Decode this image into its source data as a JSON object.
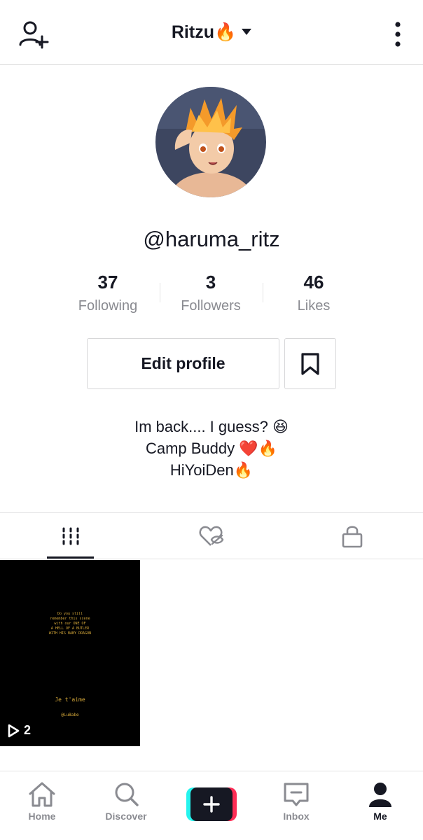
{
  "header": {
    "title": "Ritzu",
    "title_emoji": "🔥",
    "left_icon": "add-user-icon",
    "right_icon": "more-vertical-icon"
  },
  "profile": {
    "username": "@haruma_ritz",
    "stats": [
      {
        "value": "37",
        "label": "Following"
      },
      {
        "value": "3",
        "label": "Followers"
      },
      {
        "value": "46",
        "label": "Likes"
      }
    ],
    "edit_button": "Edit profile",
    "bio": [
      "Im back.... I guess? 😆",
      "Camp Buddy ❤️🔥",
      "HiYoiDen🔥"
    ]
  },
  "tabs": [
    {
      "icon": "grid-icon",
      "active": true
    },
    {
      "icon": "liked-hidden-icon",
      "active": false
    },
    {
      "icon": "lock-icon",
      "active": false
    }
  ],
  "videos": [
    {
      "caption_lines": [
        "Do you still",
        "remember this scene",
        "with our ONE OF",
        "A HELL OF A BUTLER",
        "WITH HIS BABY DRAGON"
      ],
      "caption_bottom": "Je t'aime",
      "caption_tag": "@LuBabe",
      "plays": "2"
    }
  ],
  "bottom_nav": [
    {
      "label": "Home",
      "icon": "home-icon"
    },
    {
      "label": "Discover",
      "icon": "search-icon"
    },
    {
      "label": "",
      "icon": "plus-icon"
    },
    {
      "label": "Inbox",
      "icon": "inbox-icon"
    },
    {
      "label": "Me",
      "icon": "person-icon",
      "active": true
    }
  ],
  "colors": {
    "text": "#161823",
    "muted": "#8a8b91",
    "cyan": "#25f4ee",
    "pink": "#fe2c55"
  }
}
